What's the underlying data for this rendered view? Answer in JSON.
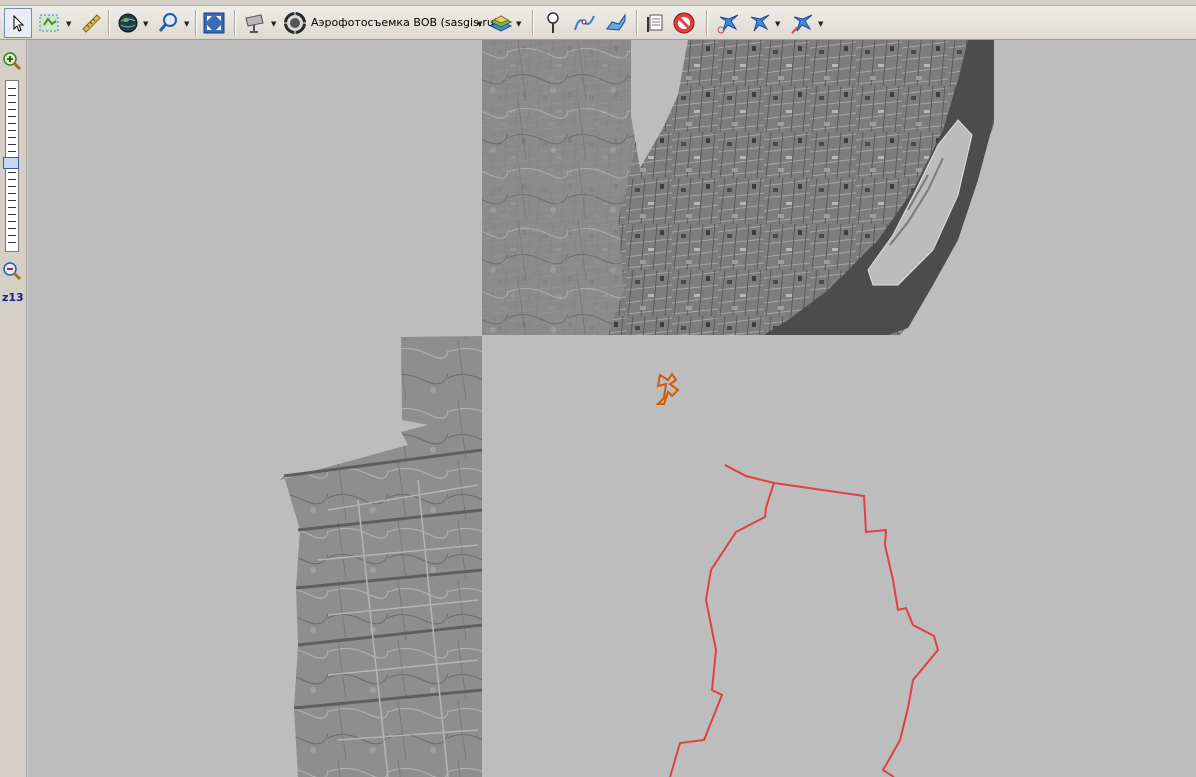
{
  "toolbar": {
    "tools": [
      {
        "name": "select-tool",
        "icon": "cursor-arrow-icon"
      },
      {
        "name": "select-area-tool",
        "icon": "area-select-icon"
      },
      {
        "name": "measure-tool",
        "icon": "ruler-icon"
      },
      {
        "name": "globe-tool",
        "icon": "globe-icon"
      },
      {
        "name": "zoom-tool",
        "icon": "magnifier-icon"
      },
      {
        "name": "fullscreen-tool",
        "icon": "fullscreen-icon"
      },
      {
        "name": "gps-tool",
        "icon": "satellite-dish-icon"
      },
      {
        "name": "map-type-tool",
        "icon": "map-source-icon"
      },
      {
        "name": "layers-tool",
        "icon": "layers-icon"
      },
      {
        "name": "add-placemark-tool",
        "icon": "placemark-icon"
      },
      {
        "name": "add-path-tool",
        "icon": "path-icon"
      },
      {
        "name": "add-polygon-tool",
        "icon": "polygon-icon"
      },
      {
        "name": "marks-list-tool",
        "icon": "marks-list-icon"
      },
      {
        "name": "hide-marks-tool",
        "icon": "no-marks-icon"
      },
      {
        "name": "gps-track-tool",
        "icon": "gps-track-icon"
      },
      {
        "name": "gps-connect-tool",
        "icon": "gps-connect-icon"
      },
      {
        "name": "gps-settings-tool",
        "icon": "gps-settings-icon"
      }
    ],
    "map_type_label": "Аэрофотосъемка ВОВ (sasgis.ru)"
  },
  "sidebar": {
    "zoom_in": "zoom-in-icon",
    "zoom_out": "zoom-out-icon",
    "zoom_level": "z13"
  },
  "map": {
    "background_color": "#bdbdbd",
    "track_color": "#e04040",
    "placemark_color": "#cc5a10"
  }
}
